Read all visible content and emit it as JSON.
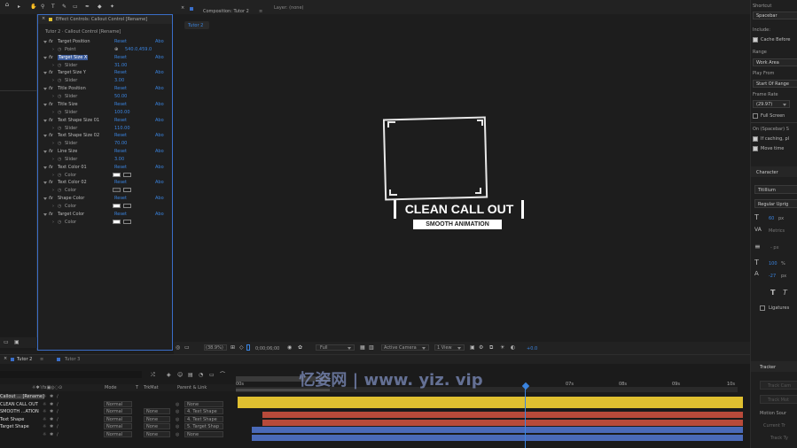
{
  "top": {
    "effect_controls_tab": "Effect Controls: Callout Control [Rename]",
    "composition_tab": "Composition: Tutor 2",
    "layer_tab": "Layer: (none)",
    "comp_flow": "Tutor 2",
    "ec_header": "Tutor 2 · Callout Control [Rename]"
  },
  "effects": [
    {
      "name": "Target Position",
      "reset": "Reset",
      "about": "Abo",
      "param": "Point",
      "value": "540.0,459.0",
      "kind": "point"
    },
    {
      "name": "Target Size X",
      "reset": "Reset",
      "about": "Abo",
      "param": "Slider",
      "value": "31.00",
      "kind": "slider"
    },
    {
      "name": "Target Size Y",
      "reset": "Reset",
      "about": "Abo",
      "param": "Slider",
      "value": "3.00",
      "kind": "slider"
    },
    {
      "name": "Title Position",
      "reset": "Reset",
      "about": "Abo",
      "param": "Slider",
      "value": "50.00",
      "kind": "slider"
    },
    {
      "name": "Title Size",
      "reset": "Reset",
      "about": "Abo",
      "param": "Slider",
      "value": "100.00",
      "kind": "slider"
    },
    {
      "name": "Text Shape Size 01",
      "reset": "Reset",
      "about": "Abo",
      "param": "Slider",
      "value": "110.00",
      "kind": "slider"
    },
    {
      "name": "Text Shape Size 02",
      "reset": "Reset",
      "about": "Abo",
      "param": "Slider",
      "value": "70.00",
      "kind": "slider"
    },
    {
      "name": "Line Size",
      "reset": "Reset",
      "about": "Abo",
      "param": "Slider",
      "value": "3.00",
      "kind": "slider"
    },
    {
      "name": "Text Color 01",
      "reset": "Reset",
      "about": "Abo",
      "param": "Color",
      "value": "",
      "kind": "color",
      "color": "#ffffff"
    },
    {
      "name": "Text Color 02",
      "reset": "Reset",
      "about": "Abo",
      "param": "Color",
      "value": "",
      "kind": "color",
      "color": "#2b2b2b"
    },
    {
      "name": "Shape Color",
      "reset": "Reset",
      "about": "Abo",
      "param": "Color",
      "value": "",
      "kind": "color",
      "color": "#ffffff"
    },
    {
      "name": "Target Color",
      "reset": "Reset",
      "about": "Abo",
      "param": "Color",
      "value": "",
      "kind": "color",
      "color": "#ffffff"
    }
  ],
  "callout": {
    "title": "CLEAN CALL OUT",
    "subtitle": "SMOOTH ANIMATION"
  },
  "viewer_bar": {
    "zoom": "(38.9%)",
    "timecode": "0;00;06;00",
    "resolution": "Full",
    "camera": "Active Camera",
    "views": "1 View",
    "exposure": "+0.0"
  },
  "right_panel": {
    "shortcut_label": "Shortcut",
    "shortcut_value": "Spacebar",
    "include_label": "Include:",
    "cache_before": "Cache Before",
    "range_label": "Range",
    "range_value": "Work Area",
    "play_from_label": "Play From",
    "play_from_value": "Start Of Range",
    "frame_rate_label": "Frame Rate",
    "frame_rate_value": "(29.97)",
    "full_screen": "Full Screen",
    "on_spacebar": "On (Spacebar) S",
    "if_caching": "If caching, pl",
    "move_time": "Move time",
    "character_title": "Character",
    "font_name": "Titillium",
    "font_style": "Regular Uprig",
    "font_size": "60",
    "font_unit": "px",
    "kerning": "Metrics",
    "leading": "- px",
    "scale": "100",
    "scale_unit": "%",
    "baseline": "-27",
    "baseline_unit": "px",
    "ligatures": "Ligatures",
    "tracker_title": "Tracker",
    "track_camera": "Track Cam",
    "track_motion": "Track Mot",
    "motion_source": "Motion Sour",
    "current_track": "Current Tr",
    "track_type": "Track Ty"
  },
  "timeline": {
    "tabs": [
      "Tutor 2",
      "Tutor 3"
    ],
    "columns": {
      "mode": "Mode",
      "t": "T",
      "trkmat": "TrkMat",
      "parent": "Parent & Link"
    },
    "layers": [
      {
        "name": "Callout ... [Rename]",
        "mode": "",
        "trkmat": "",
        "parent": "",
        "color": "#e0c030"
      },
      {
        "name": "CLEAN CALL OUT",
        "mode": "Normal",
        "trkmat": "",
        "parent": "None",
        "color": "#e0c030"
      },
      {
        "name": "SMOOTH ...ATION",
        "mode": "Normal",
        "trkmat": "None",
        "parent": "4. Text Shape",
        "color": "#b84a3a"
      },
      {
        "name": "Text Shape",
        "mode": "Normal",
        "trkmat": "None",
        "parent": "4. Text Shape",
        "color": "#b84a3a"
      },
      {
        "name": "Target Shape",
        "mode": "Normal",
        "trkmat": "None",
        "parent": "5. Target Shap",
        "color": "#4a6ab8"
      },
      {
        "name": "",
        "mode": "Normal",
        "trkmat": "None",
        "parent": "None",
        "color": "#4a6ab8"
      }
    ],
    "ruler": [
      "00s",
      "07s",
      "08s",
      "09s",
      "10s"
    ],
    "watermark": "忆姿网 | www. yiz. vip"
  }
}
